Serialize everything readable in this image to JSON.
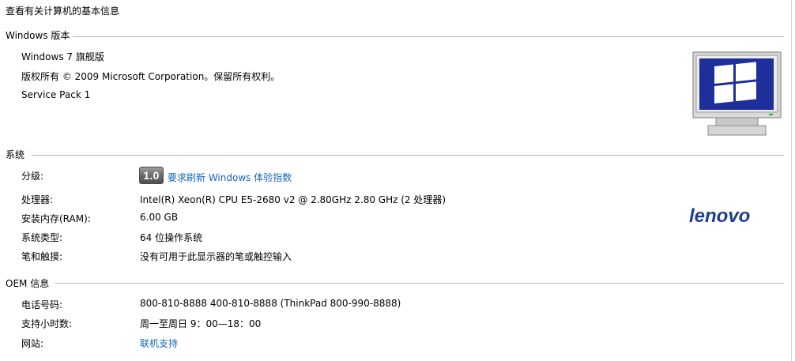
{
  "page": {
    "title": "查看有关计算机的基本信息"
  },
  "edition": {
    "header": "Windows 版本",
    "name": "Windows 7 旗舰版",
    "copyright": "版权所有 © 2009 Microsoft Corporation。保留所有权利。",
    "service_pack": "Service Pack 1"
  },
  "system": {
    "header": "系统",
    "rows": [
      {
        "label": "分级:",
        "score": "1.0",
        "value": "要求刷新 Windows 体验指数"
      },
      {
        "label": "处理器:",
        "value": "Intel(R) Xeon(R) CPU E5-2680 v2 @ 2.80GHz   2.80 GHz  (2 处理器)"
      },
      {
        "label": "安装内存(RAM):",
        "value": "6.00 GB"
      },
      {
        "label": "系统类型:",
        "value": "64 位操作系统"
      },
      {
        "label": "笔和触摸:",
        "value": "没有可用于此显示器的笔或触控输入"
      }
    ]
  },
  "oem": {
    "header": "OEM 信息",
    "rows": [
      {
        "label": "电话号码:",
        "value": "800-810-8888 400-810-8888 (ThinkPad 800-990-8888)"
      },
      {
        "label": "支持小时数:",
        "value": "周一至周日 9：00—18：00"
      },
      {
        "label": "网站:",
        "value": "联机支持"
      }
    ],
    "logo_text": "lenovo"
  },
  "icons": {
    "monitor": "windows-monitor-icon",
    "oem_logo": "lenovo-logo"
  },
  "colors": {
    "link": "#1565c0",
    "rule": "#b4b4b4",
    "logo_blue": "#1e3f8f",
    "screen_blue": "#1e2f9c"
  }
}
